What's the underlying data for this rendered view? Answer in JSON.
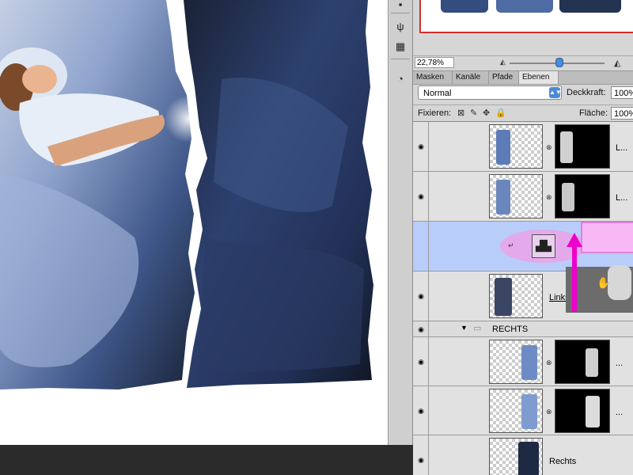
{
  "canvas": {
    "photo_colors": {
      "dark": "#101826",
      "blue": "#3a5486",
      "light": "#c9d4ea"
    }
  },
  "navigator": {
    "zoom_value": "22,78%",
    "zoom_level_fraction": 0.55
  },
  "tabs": [
    {
      "label": "Masken",
      "active": false
    },
    {
      "label": "Kanäle",
      "active": false
    },
    {
      "label": "Pfade",
      "active": false
    },
    {
      "label": "Ebenen",
      "active": true
    }
  ],
  "layers_panel": {
    "blend_mode": "Normal",
    "opacity_label": "Deckkraft:",
    "opacity_value": "100%",
    "lock_label": "Fixieren:",
    "fill_label": "Fläche:",
    "fill_value": "100%",
    "layers": [
      {
        "name": "L...",
        "type": "masked"
      },
      {
        "name": "L...",
        "type": "masked"
      },
      {
        "name": "",
        "type": "adjustment",
        "selected": true
      },
      {
        "name": "Links",
        "type": "pixel"
      },
      {
        "name": "RECHTS",
        "type": "group"
      },
      {
        "name": "...",
        "type": "masked"
      },
      {
        "name": "...",
        "type": "masked"
      },
      {
        "name": "Rechts",
        "type": "pixel"
      }
    ]
  },
  "drag_overlay": {
    "arrow_color": "#ee00cc",
    "highlight_color": "#e6a6ea",
    "popup_color": "#f7b8f5"
  },
  "icons": {
    "eye": "eye-icon",
    "chain": "chain-link-icon",
    "folder": "folder-icon",
    "levels": "levels-adjustment-icon",
    "hand_cursor": "hand-cursor-icon"
  }
}
